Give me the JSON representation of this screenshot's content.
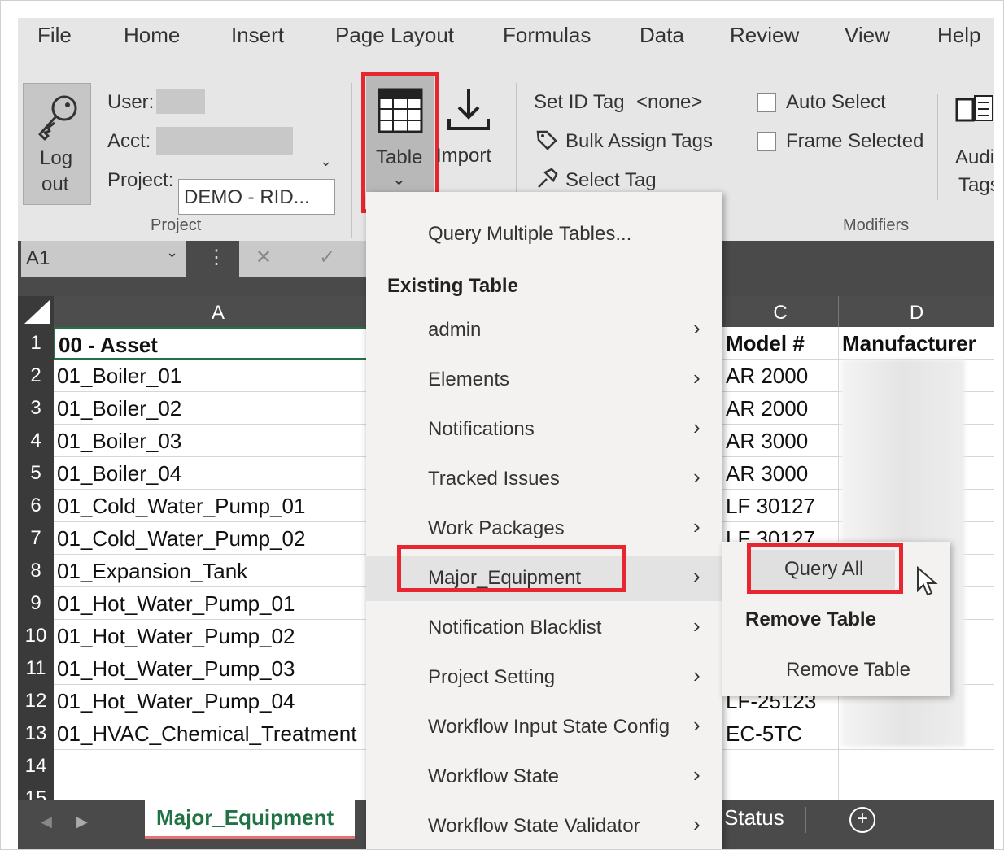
{
  "menubar": {
    "items": [
      "File",
      "Home",
      "Insert",
      "Page Layout",
      "Formulas",
      "Data",
      "Review",
      "View",
      "Help"
    ]
  },
  "ribbon": {
    "logout": {
      "line1": "Log",
      "line2": "out"
    },
    "user_label": "User:",
    "acct_label": "Acct:",
    "project_label": "Project:",
    "project_value": "DEMO - RID...",
    "project_group": "Project",
    "table_label": "Table",
    "table_chevron": "⌄",
    "import_label": "Import",
    "set_id_tag": "Set ID Tag",
    "set_id_value": "<none>",
    "bulk_assign": "Bulk Assign Tags",
    "select_tag": "Select Tag",
    "auto_select": "Auto Select",
    "frame_selected": "Frame Selected",
    "modifiers_group": "Modifiers",
    "audit_line1": "Audi",
    "audit_line2": "Tags"
  },
  "formula_bar": {
    "name_box": "A1",
    "dots": "⋮",
    "cancel": "✕",
    "enter": "✓"
  },
  "columns": {
    "a": "A",
    "c": "C",
    "d": "D"
  },
  "rows": [
    {
      "num": "1",
      "a": "00 - Asset",
      "c": "Model #",
      "d": "Manufacturer"
    },
    {
      "num": "2",
      "a": "01_Boiler_01",
      "c": "AR 2000"
    },
    {
      "num": "3",
      "a": "01_Boiler_02",
      "c": "AR 2000"
    },
    {
      "num": "4",
      "a": "01_Boiler_03",
      "c": "AR 3000"
    },
    {
      "num": "5",
      "a": "01_Boiler_04",
      "c": "AR 3000"
    },
    {
      "num": "6",
      "a": "01_Cold_Water_Pump_01",
      "c": "LF 30127"
    },
    {
      "num": "7",
      "a": "01_Cold_Water_Pump_02",
      "c": "LF 30127"
    },
    {
      "num": "8",
      "a": "01_Expansion_Tank",
      "c": ""
    },
    {
      "num": "9",
      "a": "01_Hot_Water_Pump_01",
      "c": ""
    },
    {
      "num": "10",
      "a": "01_Hot_Water_Pump_02",
      "c": ""
    },
    {
      "num": "11",
      "a": "01_Hot_Water_Pump_03",
      "c": ""
    },
    {
      "num": "12",
      "a": "01_Hot_Water_Pump_04",
      "c": "LF-25123"
    },
    {
      "num": "13",
      "a": "01_HVAC_Chemical_Treatment",
      "c": "EC-5TC"
    },
    {
      "num": "14",
      "a": "",
      "c": ""
    },
    {
      "num": "15",
      "a": "",
      "c": ""
    }
  ],
  "tabs": {
    "nav_prev": "◀",
    "nav_next": "▶",
    "active": "Major_Equipment",
    "other": "Status",
    "add": "+"
  },
  "dropdown": {
    "query_multiple": "Query Multiple Tables...",
    "existing_header": "Existing Table",
    "items": [
      "admin",
      "Elements",
      "Notifications",
      "Tracked Issues",
      "Work Packages",
      "Major_Equipment",
      "Notification Blacklist",
      "Project Setting",
      "Workflow Input State Config",
      "Workflow State",
      "Workflow State Validator"
    ],
    "chevron": "›"
  },
  "submenu": {
    "query_all": "Query All",
    "remove_header": "Remove Table",
    "remove_item": "Remove Table"
  },
  "colors": {
    "highlight_red": "#e8262f",
    "active_tab_green": "#217346"
  }
}
